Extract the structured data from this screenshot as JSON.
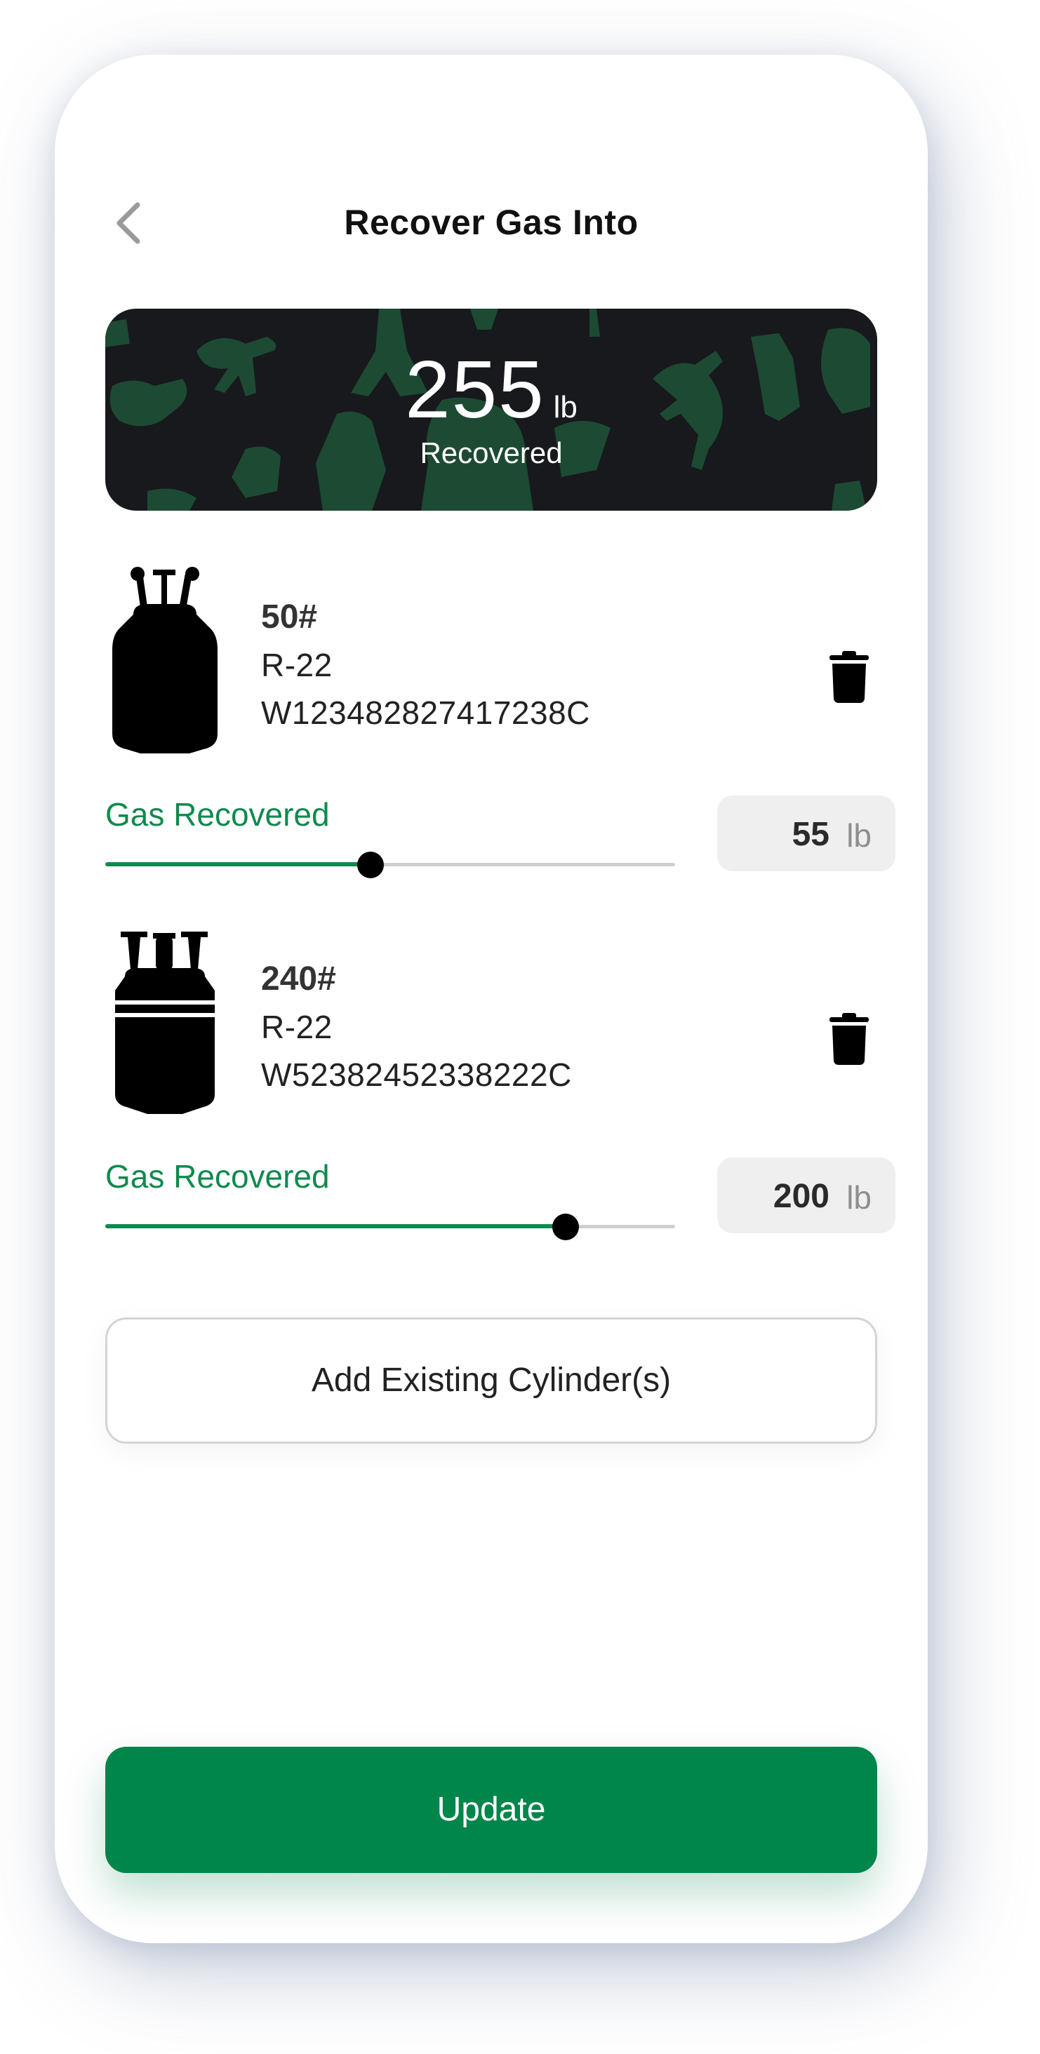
{
  "header": {
    "title": "Recover Gas Into",
    "back_icon": "chevron-left-icon"
  },
  "summary": {
    "value": "255",
    "unit": "lb",
    "label": "Recovered"
  },
  "cylinders": [
    {
      "size": "50#",
      "gas": "R-22",
      "serial": "W123482827417238C",
      "gas_label": "Gas Recovered",
      "recovered": "55",
      "unit": "lb",
      "slider_fraction": 0.466,
      "icon": "cylinder-tank-icon"
    },
    {
      "size": "240#",
      "gas": "R-22",
      "serial": "W52382452338222C",
      "gas_label": "Gas Recovered",
      "recovered": "200",
      "unit": "lb",
      "slider_fraction": 0.808,
      "icon": "large-cylinder-tank-icon"
    }
  ],
  "add_button": {
    "label": "Add Existing Cylinder(s)"
  },
  "update_button": {
    "label": "Update"
  },
  "colors": {
    "accent": "#00854a",
    "label_green": "#0f8a4e",
    "card_bg": "#17191c",
    "silhouette_green": "#1d4a33"
  }
}
